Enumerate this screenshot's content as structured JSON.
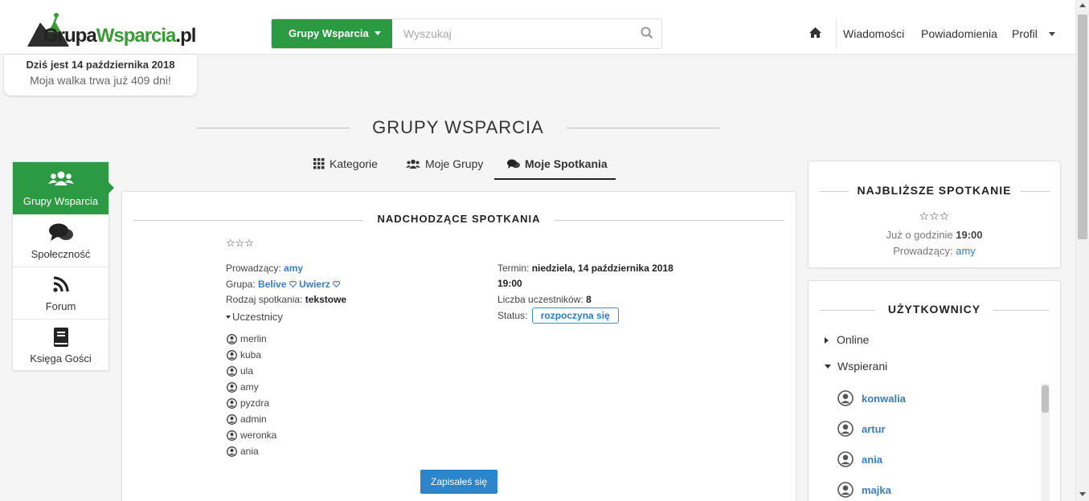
{
  "header": {
    "logo": {
      "part1": "Grupa",
      "part2": "Wsparcia",
      "part3": ".pl"
    },
    "search": {
      "category": "Grupy Wsparcia",
      "placeholder": "Wyszukaj"
    },
    "nav": {
      "messages": "Wiadomości",
      "notifications": "Powiadomienia",
      "profile": "Profil"
    }
  },
  "datebox": {
    "line1": "Dziś jest 14 października 2018",
    "line2": "Moja walka trwa już 409 dni!"
  },
  "page_title": "GRUPY WSPARCIA",
  "tabs": [
    {
      "label": "Kategorie",
      "icon": "grid-icon"
    },
    {
      "label": "Moje Grupy",
      "icon": "users-icon"
    },
    {
      "label": "Moje Spotkania",
      "icon": "chat-icon",
      "active": true
    }
  ],
  "sidebar": {
    "items": [
      {
        "label": "Grupy Wsparcia",
        "icon": "users-icon",
        "active": true
      },
      {
        "label": "Społeczność",
        "icon": "chat-icon"
      },
      {
        "label": "Forum",
        "icon": "rss-icon"
      },
      {
        "label": "Księga Gości",
        "icon": "book-icon"
      }
    ]
  },
  "meetings": {
    "title": "NADCHODZĄCE SPOTKANIA",
    "stars": "☆☆☆",
    "host_label": "Prowadzący:",
    "host": "amy",
    "group_label": "Grupa:",
    "group1": "Belive",
    "group2": "Uwierz",
    "type_label": "Rodzaj spotkania:",
    "type": "tekstowe",
    "participants_label": "Uczestnicy",
    "participants": [
      "merlin",
      "kuba",
      "ula",
      "amy",
      "pyzdra",
      "admin",
      "weronka",
      "ania"
    ],
    "term_label": "Termin:",
    "term_date": "niedziela, 14 października 2018",
    "term_time": "19:00",
    "count_label": "Liczba uczestników:",
    "count": "8",
    "status_label": "Status:",
    "status": "rozpoczyna się",
    "signup_button": "Zapisałeś się"
  },
  "next_meeting": {
    "title": "NAJBLIŻSZE SPOTKANIE",
    "stars": "☆☆☆",
    "time_label": "Już o godzinie",
    "time": "19:00",
    "host_label": "Prowadzący:",
    "host": "amy"
  },
  "users": {
    "title": "UŻYTKOWNICY",
    "online_label": "Online",
    "supported_label": "Wspierani",
    "list": [
      "konwalia",
      "artur",
      "ania",
      "majka"
    ]
  },
  "colors": {
    "brand_green": "#2c9a43",
    "link_blue": "#3b7dc4",
    "button_blue": "#2d84c9"
  }
}
